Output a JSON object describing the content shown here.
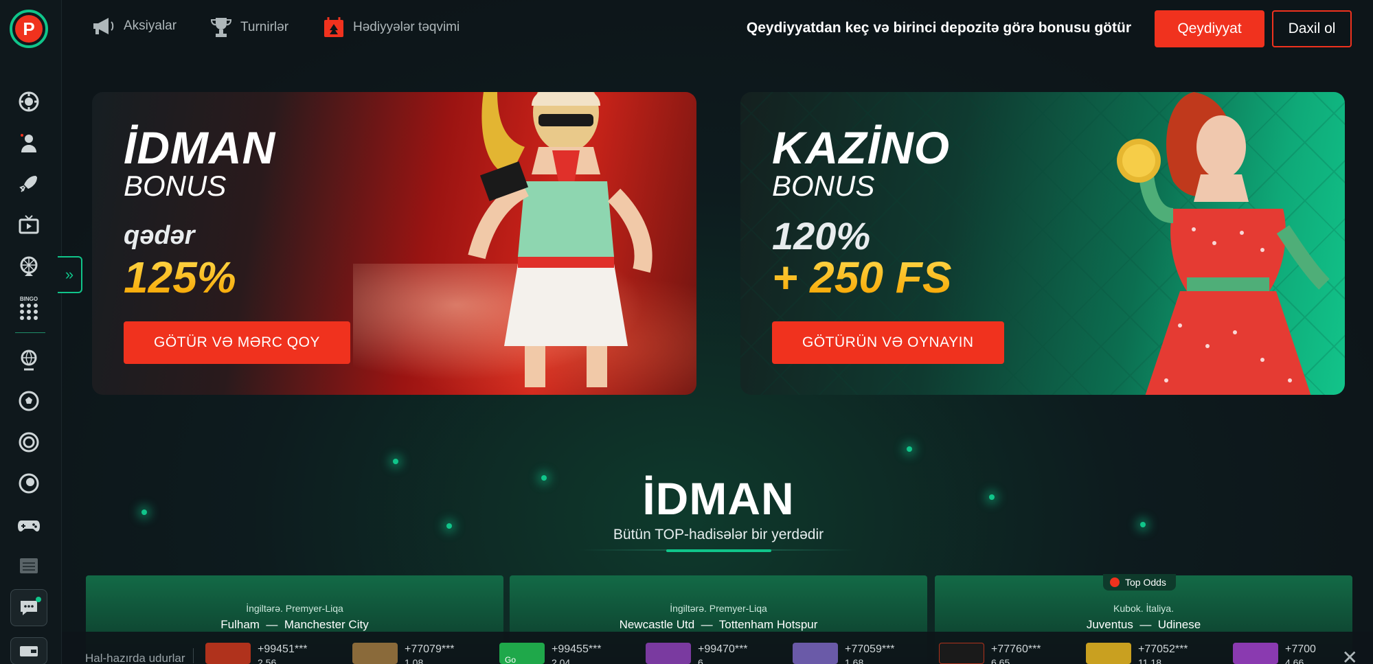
{
  "header": {
    "nav": [
      {
        "label": "Aksiyalar",
        "icon": "megaphone-icon"
      },
      {
        "label": "Turnirlər",
        "icon": "trophy-icon"
      },
      {
        "label": "Hədiyyələr təqvimi",
        "icon": "gift-calendar-icon"
      }
    ],
    "promo_text": "Qeydiyyatdan keç və birinci depozitə görə bonusu götür",
    "register_label": "Qeydiyyat",
    "login_label": "Daxil ol"
  },
  "logo": {
    "letter": "P"
  },
  "sidebar": {
    "icons": [
      "poker-chip-icon",
      "dealer-icon",
      "rocket-icon",
      "tv-icon",
      "lottery-wheel-icon",
      "bingo-icon",
      "sports-globe-icon",
      "football-icon",
      "target-icon",
      "lottery-ball-icon",
      "gamepad-icon",
      "list-icon"
    ],
    "bingo_label": "BINGO"
  },
  "banners": [
    {
      "title": "İDMAN",
      "subtitle": "BONUS",
      "line1": "qədər",
      "big": "125%",
      "cta": "GÖTÜR VƏ MƏRC QOY"
    },
    {
      "title": "KAZİNO",
      "subtitle": "BONUS",
      "line1": "120%",
      "big": "+ 250 FS",
      "cta": "GÖTÜRÜN VƏ OYNAYIN"
    }
  ],
  "section": {
    "title": "İDMAN",
    "subtitle": "Bütün TOP-hadisələr bir yerdədir"
  },
  "top_odds_label": "Top Odds",
  "matches": [
    {
      "league": "İngiltərə. Premyer-Liqa",
      "home": "Fulham",
      "away": "Manchester City",
      "sep": "—"
    },
    {
      "league": "İngiltərə. Premyer-Liqa",
      "home": "Newcastle Utd",
      "away": "Tottenham Hotspur",
      "sep": "—"
    },
    {
      "league": "Kubok. İtaliya.",
      "home": "Juventus",
      "away": "Udinese",
      "sep": "—"
    }
  ],
  "winners": {
    "label": "Hal-hazırda udurlar",
    "items": [
      {
        "user": "+99451***",
        "amount": "2.56",
        "color": "#b0321c"
      },
      {
        "user": "+77079***",
        "amount": "1.08",
        "color": "#8a6a3a"
      },
      {
        "user": "+99455***",
        "amount": "2.04",
        "color": "#1fa84a",
        "thumb_text": "Go"
      },
      {
        "user": "+99470***",
        "amount": "6",
        "color": "#7a3aa0"
      },
      {
        "user": "+77059***",
        "amount": "1.68",
        "color": "#6a5aa8"
      },
      {
        "user": "+77760***",
        "amount": "6.65",
        "color": "#1a1a1a"
      },
      {
        "user": "+77052***",
        "amount": "11.18",
        "color": "#c9a020"
      },
      {
        "user": "+7700",
        "amount": "4.66",
        "color": "#8a3ab0"
      }
    ]
  },
  "colors": {
    "accent_red": "#f0321e",
    "accent_green": "#10c58a",
    "bg": "#0d1519"
  }
}
